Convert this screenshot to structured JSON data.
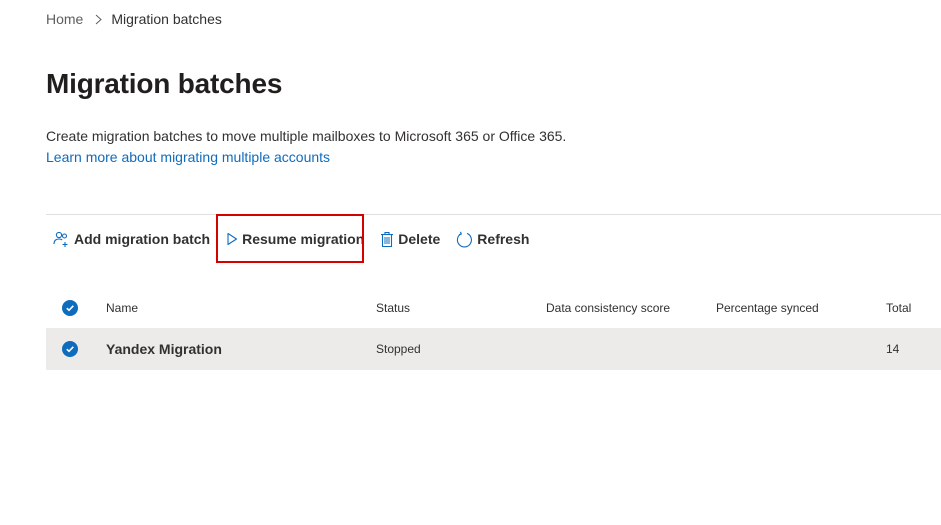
{
  "breadcrumb": {
    "home": "Home",
    "current": "Migration batches"
  },
  "page": {
    "title": "Migration batches",
    "description": "Create migration batches to move multiple mailboxes to Microsoft 365 or Office 365.",
    "learn_link": "Learn more about migrating multiple accounts"
  },
  "toolbar": {
    "add_label": "Add migration batch",
    "resume_label": "Resume migration",
    "delete_label": "Delete",
    "refresh_label": "Refresh"
  },
  "icons": {
    "add": "people-add-icon",
    "resume": "play-icon",
    "delete": "trash-icon",
    "refresh": "refresh-icon",
    "breadcrumb_sep": "chevron-right-icon",
    "check": "checkmark-circle-icon"
  },
  "colors": {
    "accent": "#0f6cbd",
    "highlight": "#d50000",
    "selected_row": "#edebe9"
  },
  "table": {
    "columns": [
      "Name",
      "Status",
      "Data consistency score",
      "Percentage synced",
      "Total"
    ],
    "rows": [
      {
        "name": "Yandex Migration",
        "status": "Stopped",
        "data_consistency_score": "",
        "percentage_synced": "",
        "total": "14",
        "selected": true
      }
    ]
  }
}
